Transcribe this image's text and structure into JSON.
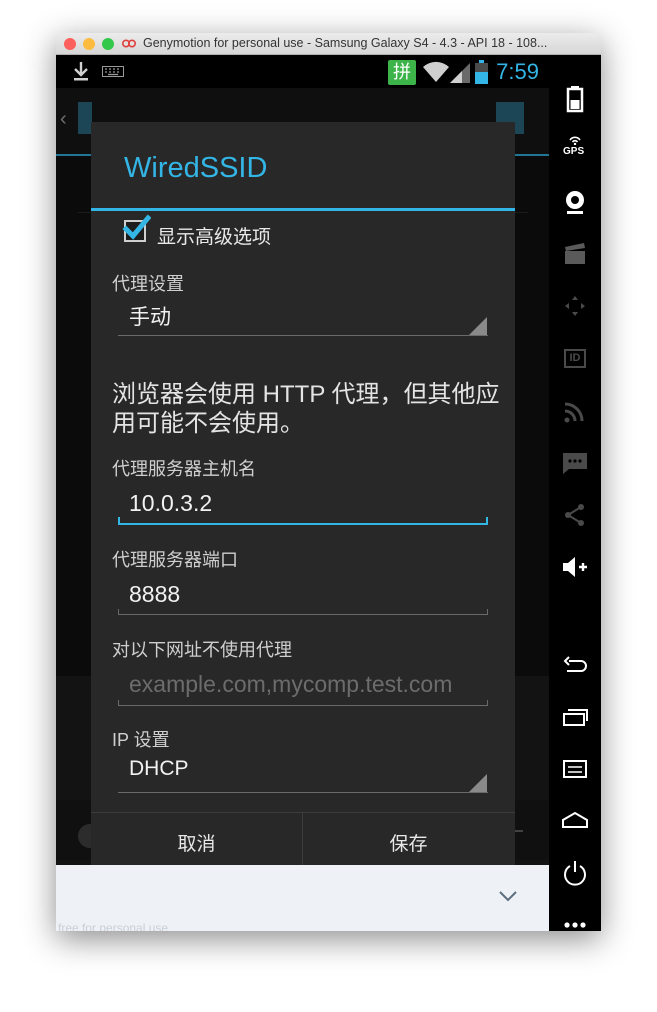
{
  "window": {
    "title": "Genymotion for personal use - Samsung Galaxy S4 - 4.3 - API 18 - 108...",
    "traffic_lights": [
      "#fc605c",
      "#fdbc40",
      "#34c84a"
    ]
  },
  "statusbar": {
    "time": "7:59",
    "ime_label": "拼",
    "icons": [
      "download-icon",
      "keyboard-icon",
      "ime-icon",
      "wifi-icon",
      "signal-icon",
      "battery-icon"
    ]
  },
  "dialog": {
    "title": "WiredSSID",
    "advanced_checkbox": {
      "label": "显示高级选项",
      "checked": true
    },
    "proxy_settings": {
      "label": "代理设置",
      "value": "手动"
    },
    "proxy_note": "浏览器会使用 HTTP 代理，但其他应用可能不会使用。",
    "proxy_hostname": {
      "label": "代理服务器主机名",
      "value": "10.0.3.2"
    },
    "proxy_port": {
      "label": "代理服务器端口",
      "value": "8888"
    },
    "bypass": {
      "label": "对以下网址不使用代理",
      "placeholder": "example.com,mycomp.test.com"
    },
    "ip_settings": {
      "label": "IP 设置",
      "value": "DHCP"
    },
    "buttons": {
      "cancel": "取消",
      "save": "保存"
    }
  },
  "keyboard_strip": {
    "watermark": "free for personal use"
  },
  "sidebar": {
    "gps_label": "GPS",
    "id_label": "ID",
    "icons": [
      "gps-icon",
      "camera-icon",
      "clapper-icon",
      "dpad-icon",
      "id-icon",
      "rss-icon",
      "sms-icon",
      "share-icon",
      "volume-up-icon",
      "back-icon",
      "recent-apps-icon",
      "menu-icon",
      "home-icon",
      "power-icon",
      "more-icon"
    ]
  },
  "colors": {
    "accent": "#33b5e5",
    "dialog_bg": "#282828",
    "ime_green": "#3cb44a"
  }
}
